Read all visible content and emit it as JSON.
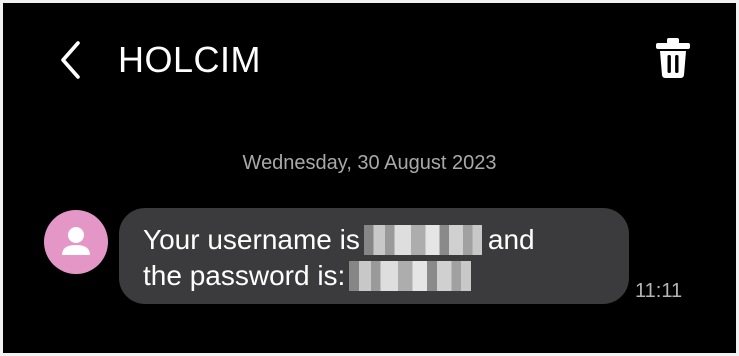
{
  "header": {
    "title": "HOLCIM",
    "back_icon": "chevron-left-icon",
    "delete_icon": "trash-icon"
  },
  "conversation": {
    "date_separator": "Wednesday, 30 August 2023",
    "messages": [
      {
        "avatar_icon": "person-icon",
        "avatar_color": "#e497c7",
        "text_part1": "Your username is",
        "text_part2": "and",
        "text_part3": "the password is:",
        "time": "11:11"
      }
    ]
  },
  "colors": {
    "background": "#000000",
    "bubble": "#3b3b3d",
    "meta_text": "#a9a9a9"
  }
}
